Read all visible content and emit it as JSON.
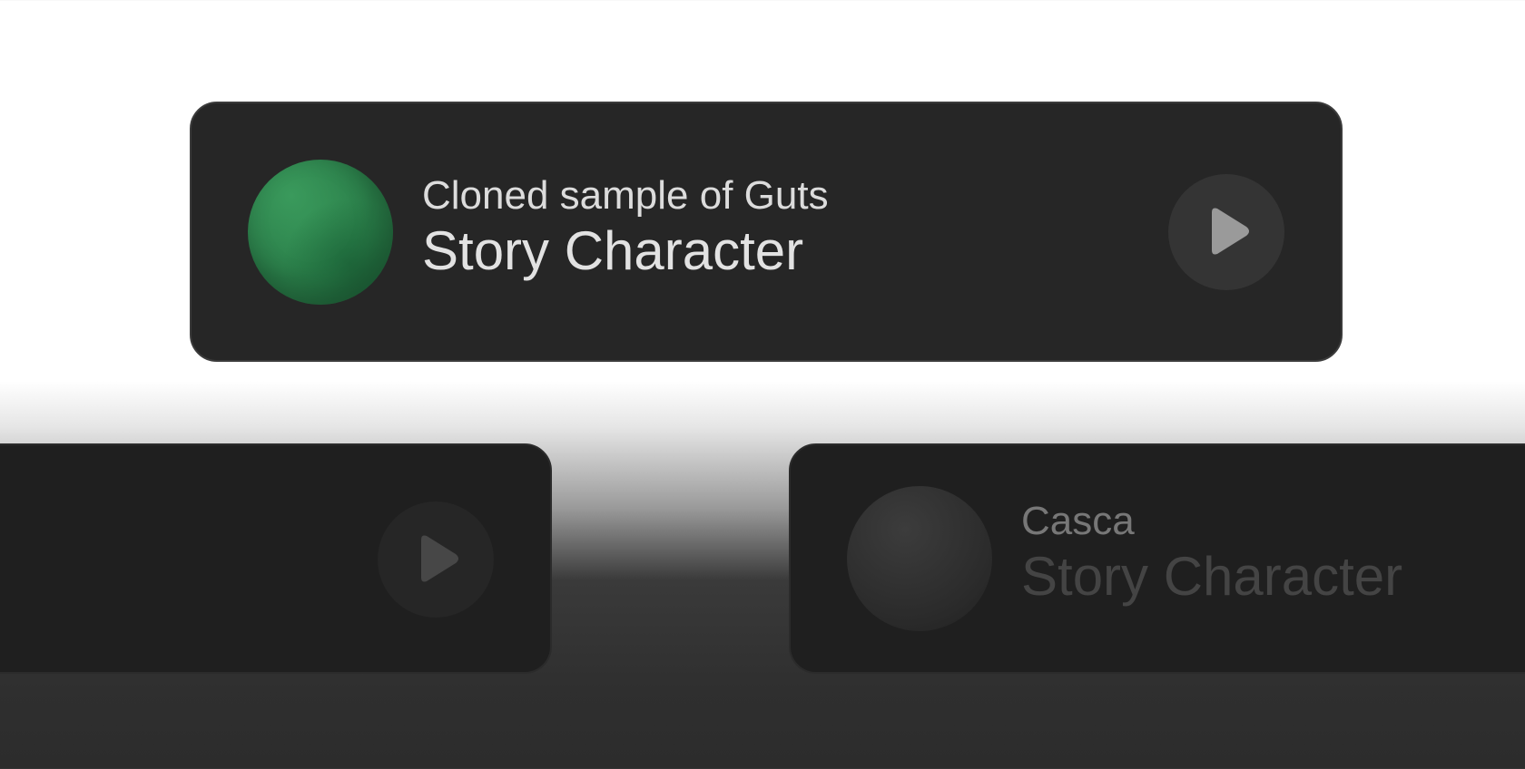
{
  "cards": [
    {
      "subtitle": "Cloned sample of Guts",
      "title": "Story Character",
      "avatar_color": "#2f8a50",
      "play_icon": "play-icon"
    },
    {
      "play_icon": "play-icon"
    },
    {
      "subtitle": "Casca",
      "title": "Story Character",
      "avatar_color": "#2e2e2e"
    }
  ],
  "colors": {
    "card_background": "#262626",
    "card_border": "#3b3b3b",
    "accent_green": "#2f8a50"
  }
}
